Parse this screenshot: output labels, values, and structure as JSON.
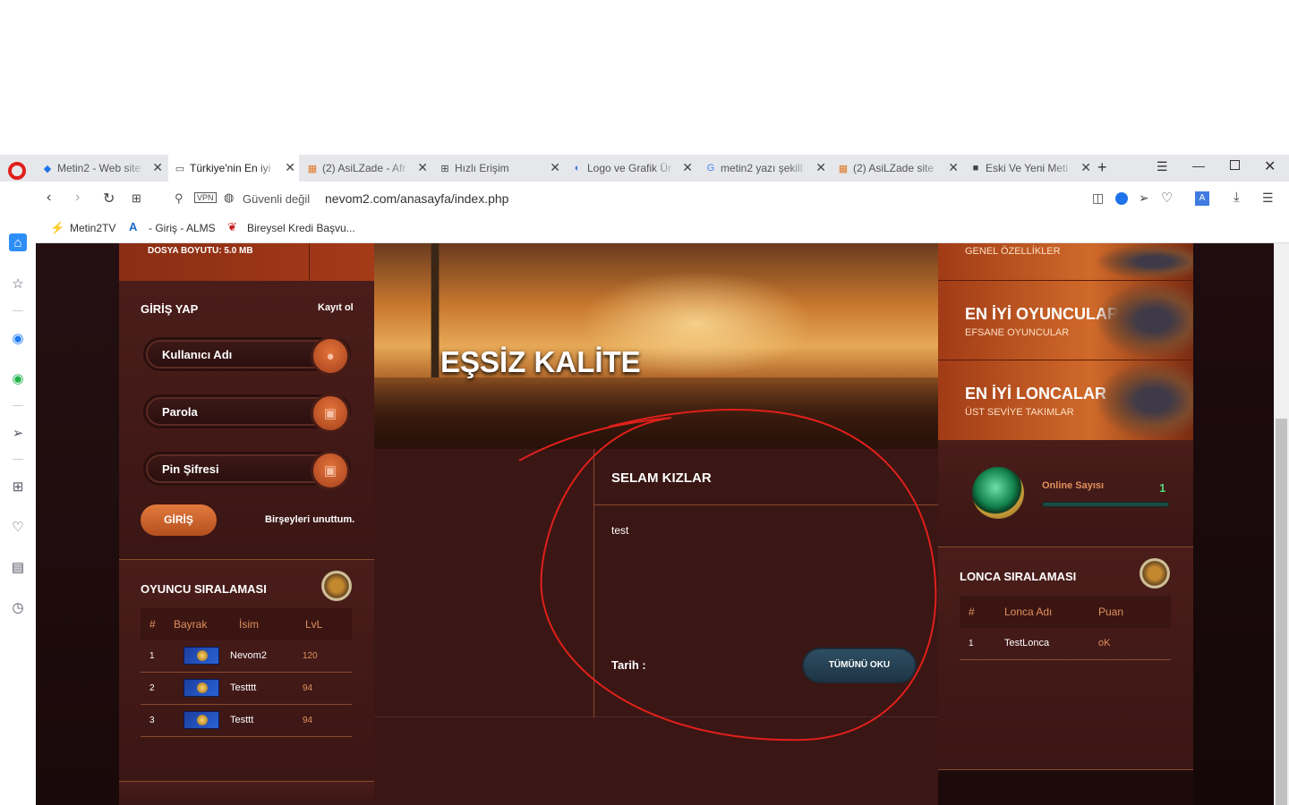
{
  "browser": {
    "tabs": [
      {
        "label": "Metin2 - Web site",
        "icon": "metin2-icon",
        "active": false
      },
      {
        "label": "Türkiye'nin En iyi",
        "icon": "page-icon",
        "active": true
      },
      {
        "label": "(2) AsiLZade - Afr",
        "icon": "asilzade-icon",
        "active": false
      },
      {
        "label": "Hızlı Erişim",
        "icon": "grid-icon",
        "active": false
      },
      {
        "label": "Logo ve Grafik Ür",
        "icon": "logo-icon",
        "active": false
      },
      {
        "label": "metin2 yazı şekill",
        "icon": "google-icon",
        "active": false
      },
      {
        "label": "(2) AsiLZade site",
        "icon": "asilzade-icon",
        "active": false
      },
      {
        "label": "Eski Ve Yeni Meti",
        "icon": "dark-site-icon",
        "active": false
      }
    ],
    "new_tab": "+",
    "address": {
      "vpn": "VPN",
      "security": "Güvenli değil",
      "url": "nevom2.com/anasayfa/index.php"
    },
    "bookmarks": [
      "Metin2TV",
      "- Giriş - ALMS",
      "Bireysel Kredi Başvu..."
    ]
  },
  "site": {
    "download_size": "DOSYA BOYUTU: 5.0 MB",
    "login": {
      "title": "GİRİŞ YAP",
      "register": "Kayıt ol",
      "username_placeholder": "Kullanıcı Adı",
      "password_placeholder": "Parola",
      "pin_placeholder": "Pin Şifresi",
      "submit": "GİRİŞ",
      "forgot": "Birşeyleri unuttum."
    },
    "player_ranking": {
      "title": "OYUNCU SIRALAMASI",
      "headers": [
        "#",
        "Bayrak",
        "İsim",
        "LvL"
      ],
      "rows": [
        {
          "rank": "1",
          "name": "Nevom2",
          "level": "120"
        },
        {
          "rank": "2",
          "name": "Testttt",
          "level": "94"
        },
        {
          "rank": "3",
          "name": "Testtt",
          "level": "94"
        }
      ]
    },
    "hero": {
      "title": "EŞSİZ KALİTE"
    },
    "news": {
      "title": "SELAM KIZLAR",
      "body": "test",
      "date_label": "Tarih :",
      "read_more": "TÜMÜNÜ OKU"
    },
    "promos": [
      {
        "title": "",
        "subtitle": "GENEL ÖZELLİKLER"
      },
      {
        "title": "EN İYİ OYUNCULAR",
        "subtitle": "EFSANE OYUNCULAR"
      },
      {
        "title": "EN İYİ LONCALAR",
        "subtitle": "ÜST SEVİYE TAKIMLAR"
      }
    ],
    "online": {
      "label": "Online Sayısı",
      "count": "1"
    },
    "guild_ranking": {
      "title": "LONCA SIRALAMASI",
      "headers": [
        "#",
        "Lonca Adı",
        "Puan"
      ],
      "rows": [
        {
          "rank": "1",
          "name": "TestLonca",
          "points": "oK"
        }
      ]
    }
  },
  "colors": {
    "accent": "#d0662b",
    "annotation": "#e0201b",
    "panel": "#3a1614"
  }
}
